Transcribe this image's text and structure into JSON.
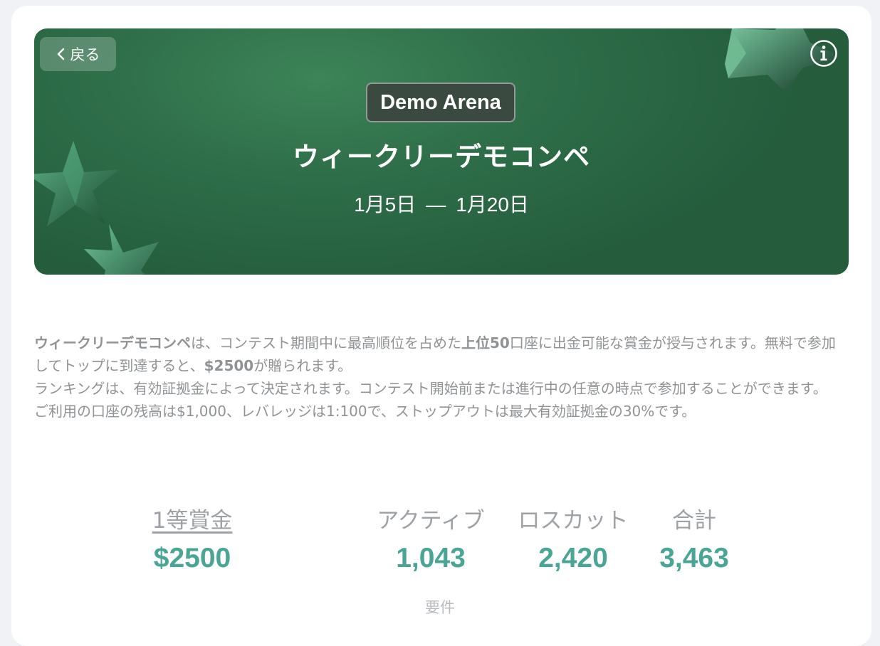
{
  "banner": {
    "back_label": "戻る",
    "badge": "Demo Arena",
    "title": "ウィークリーデモコンペ",
    "date_start": "1月5日",
    "date_sep": "—",
    "date_end": "1月20日"
  },
  "description": {
    "line1_part1": "ウィークリーデモコンペ",
    "line1_part2": "は、コンテスト期間中に最高順位を占めた",
    "line1_part3": "上位50",
    "line1_part4": "口座に出金可能な賞金が授与されます。無料で参加してトップに到達すると、",
    "line1_part5": "$2500",
    "line1_part6": "が贈られます。",
    "line2": "ランキングは、有効証拠金によって決定されます。コンテスト開始前または進行中の任意の時点で参加することができます。",
    "line3": "ご利用の口座の残高は$1,000、レバレッジは1:100で、ストップアウトは最大有効証拠金の30%です。"
  },
  "stats": {
    "prize_label": "1等賞金",
    "prize_value": "$2500",
    "active_label": "アクティブ",
    "active_value": "1,043",
    "stopout_label": "ロスカット",
    "stopout_value": "2,420",
    "total_label": "合計",
    "total_value": "3,463"
  },
  "requirements_label": "要件",
  "colors": {
    "banner_green": "#2e6e49",
    "accent_teal": "#4aa594",
    "muted_text": "#8f9396"
  }
}
